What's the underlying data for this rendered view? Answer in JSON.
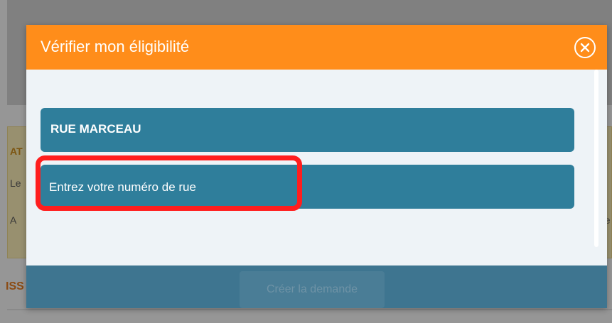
{
  "background": {
    "alert_title": "AT",
    "line1": "Le",
    "line2": "A",
    "line2_right": "ée",
    "section_title": "ISS"
  },
  "modal": {
    "title": "Vérifier mon éligibilité",
    "close_icon": "close-circle-icon",
    "street_value": "RUE MARCEAU",
    "number_placeholder": "Entrez votre numéro de rue",
    "create_button_label": "Créer la demande"
  },
  "colors": {
    "header_orange": "#ff8d1a",
    "field_blue": "#2f7e9b",
    "footer_blue": "#3e7590",
    "highlight_red": "#ff1e1e"
  }
}
